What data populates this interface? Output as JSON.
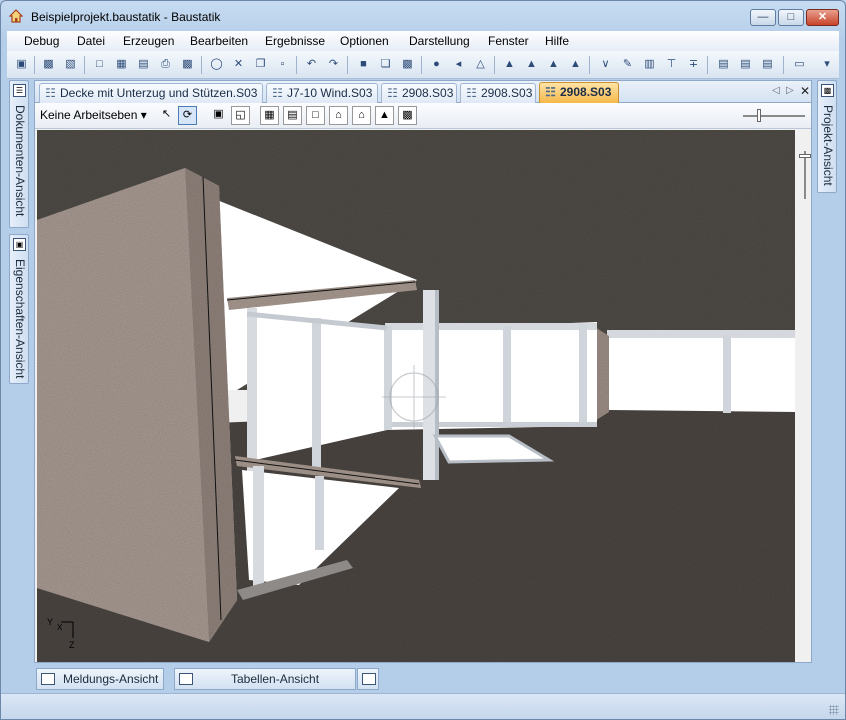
{
  "window": {
    "title": "Beispielprojekt.baustatik - Baustatik",
    "minimize_glyph": "—",
    "maximize_glyph": "□",
    "close_glyph": "✕"
  },
  "menu": [
    "Debug",
    "Datei",
    "Erzeugen",
    "Bearbeiten",
    "Ergebnisse",
    "Optionen",
    "Darstellung",
    "Fenster",
    "Hilfe"
  ],
  "side_panels": {
    "left_top": "Dokumenten-Ansicht",
    "left_bottom": "Eigenschaften-Ansicht",
    "right": "Projekt-Ansicht"
  },
  "tabs": [
    {
      "label": "Decke mit Unterzug und Stützen.S03",
      "active": false
    },
    {
      "label": "J7-10 Wind.S03",
      "active": false
    },
    {
      "label": "2908.S03",
      "active": false
    },
    {
      "label": "2908.S03",
      "active": false
    },
    {
      "label": "2908.S03",
      "active": true
    }
  ],
  "tab_nav": {
    "prev": "◁",
    "next": "▷",
    "close": "✕"
  },
  "view_toolbar": {
    "layer_dropdown": "Keine Arbeitseben",
    "dropdown_arrow": "▾"
  },
  "viewport": {
    "axis_labels": {
      "y": "Y",
      "x": "X",
      "z": "Z"
    }
  },
  "bottom_panels": {
    "messages": "Meldungs-Ansicht",
    "tables": "Tabellen-Ansicht"
  },
  "colors": {
    "floor": "#4a4642",
    "ceiling": "#4d4844",
    "wall": "#a89a92",
    "window_white": "#ffffff",
    "column": "#dfe3e8",
    "active_tab": "#f6b84a"
  }
}
